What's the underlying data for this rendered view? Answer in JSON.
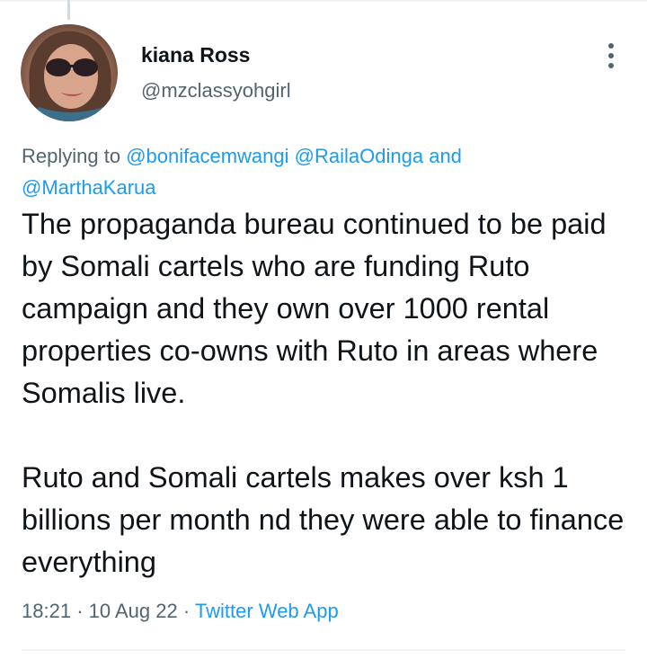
{
  "author": {
    "name": "kiana Ross",
    "handle": "@mzclassyohgirl",
    "avatar_icon": "profile-photo"
  },
  "reply": {
    "prefix": "Replying to",
    "mentions": [
      "@bonifacemwangi",
      "@RailaOdinga",
      "@MarthaKarua"
    ],
    "conjunction": "and"
  },
  "tweet": {
    "paragraphs": [
      "The propaganda bureau continued to be paid by Somali cartels who are funding Ruto campaign and they own over 1000 rental properties co-owns with Ruto in areas where Somalis live.",
      "Ruto and Somali cartels makes over ksh 1 billions per month nd they were able to finance everything"
    ],
    "time": "18:21",
    "separator": "·",
    "date": "10 Aug 22",
    "source": "Twitter Web App"
  },
  "colors": {
    "text_primary": "#0f1419",
    "text_secondary": "#536471",
    "accent": "#1d9bf0",
    "divider": "#eff3f4"
  },
  "icons": {
    "more": "more-vertical-icon"
  }
}
